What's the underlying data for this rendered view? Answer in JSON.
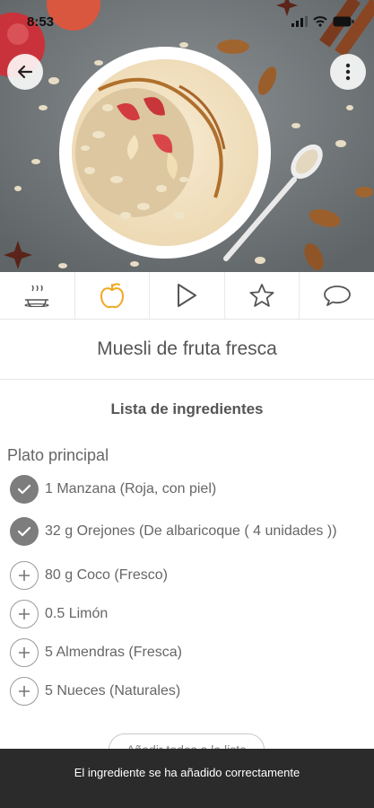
{
  "status_bar": {
    "time": "8:53"
  },
  "hero": {
    "image": "muesli-bowl-photo"
  },
  "tabs": [
    {
      "name": "tab-overview",
      "icon": "dish-icon",
      "active": false
    },
    {
      "name": "tab-ingredients",
      "icon": "apple-icon",
      "active": true
    },
    {
      "name": "tab-steps",
      "icon": "play-icon",
      "active": false
    },
    {
      "name": "tab-rating",
      "icon": "star-icon",
      "active": false
    },
    {
      "name": "tab-comments",
      "icon": "comment-icon",
      "active": false
    }
  ],
  "recipe": {
    "title": "Muesli de fruta fresca"
  },
  "ingredients": {
    "section_title": "Lista de ingredientes",
    "group_label": "Plato principal",
    "items": [
      {
        "text": "1 Manzana (Roja, con piel)",
        "checked": true
      },
      {
        "text": "32 g Orejones (De albaricoque ( 4 unidades ))",
        "checked": true
      },
      {
        "text": "80 g Coco (Fresco)",
        "checked": false
      },
      {
        "text": "0.5 Limón",
        "checked": false
      },
      {
        "text": "5 Almendras (Fresca)",
        "checked": false
      },
      {
        "text": "5 Nueces (Naturales)",
        "checked": false
      }
    ],
    "add_all_label": "Añadir todos a la lista"
  },
  "toast": {
    "message": "El ingrediente se ha añadido correctamente"
  },
  "colors": {
    "accent": "#f0a81e",
    "checked": "#7d7d7d",
    "toast_bg": "#2b2b2b"
  }
}
